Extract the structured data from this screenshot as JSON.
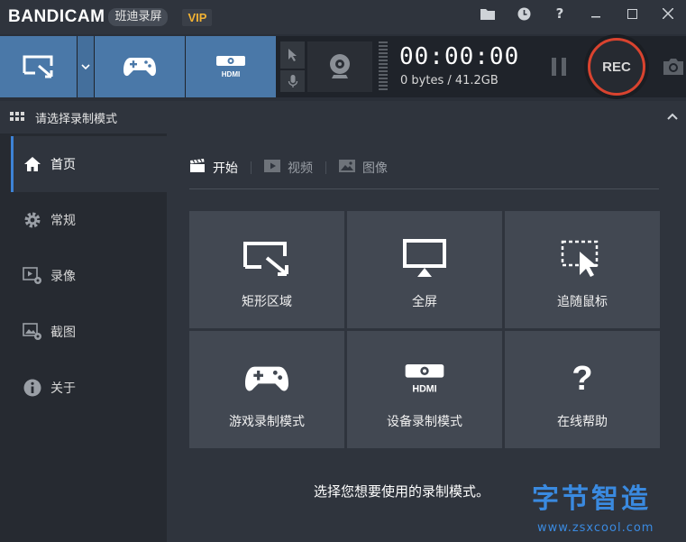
{
  "titlebar": {
    "logo": "BANDICAM",
    "logo_sub": "班迪录屏",
    "vip": "VIP",
    "icons": [
      "folder-icon",
      "clock-icon",
      "help-icon",
      "minimize-icon",
      "maximize-icon",
      "close-icon"
    ],
    "help_glyph": "?"
  },
  "toolbar": {
    "timer": "00:00:00",
    "bytes": "0 bytes / 41.2GB",
    "rec_label": "REC",
    "hdmi_text": "HDMI"
  },
  "modebar": {
    "title": "请选择录制模式"
  },
  "sidebar": {
    "items": [
      {
        "label": "首页",
        "icon": "home-icon"
      },
      {
        "label": "常规",
        "icon": "gear-icon"
      },
      {
        "label": "录像",
        "icon": "video-settings-icon"
      },
      {
        "label": "截图",
        "icon": "image-settings-icon"
      },
      {
        "label": "关于",
        "icon": "info-icon"
      }
    ]
  },
  "main": {
    "tabs": [
      {
        "label": "开始",
        "icon": "clapper-icon"
      },
      {
        "label": "视频",
        "icon": "play-icon"
      },
      {
        "label": "图像",
        "icon": "picture-icon"
      }
    ],
    "cards": [
      {
        "label": "矩形区域",
        "icon": "rectangle-area-icon"
      },
      {
        "label": "全屏",
        "icon": "monitor-icon"
      },
      {
        "label": "追随鼠标",
        "icon": "follow-mouse-icon"
      },
      {
        "label": "游戏录制模式",
        "icon": "gamepad-icon"
      },
      {
        "label": "设备录制模式",
        "icon": "hdmi-icon"
      },
      {
        "label": "在线帮助",
        "icon": "question-icon"
      }
    ],
    "hdmi_text": "HDMI",
    "help_glyph": "?",
    "hint": "选择您想要使用的录制模式。"
  },
  "watermark": {
    "line1": "字节智造",
    "line2": "www.zsxcool.com"
  },
  "colors": {
    "accent": "#4a78a8",
    "rec_ring": "#d9432f",
    "active_indicator": "#3d82d6"
  }
}
